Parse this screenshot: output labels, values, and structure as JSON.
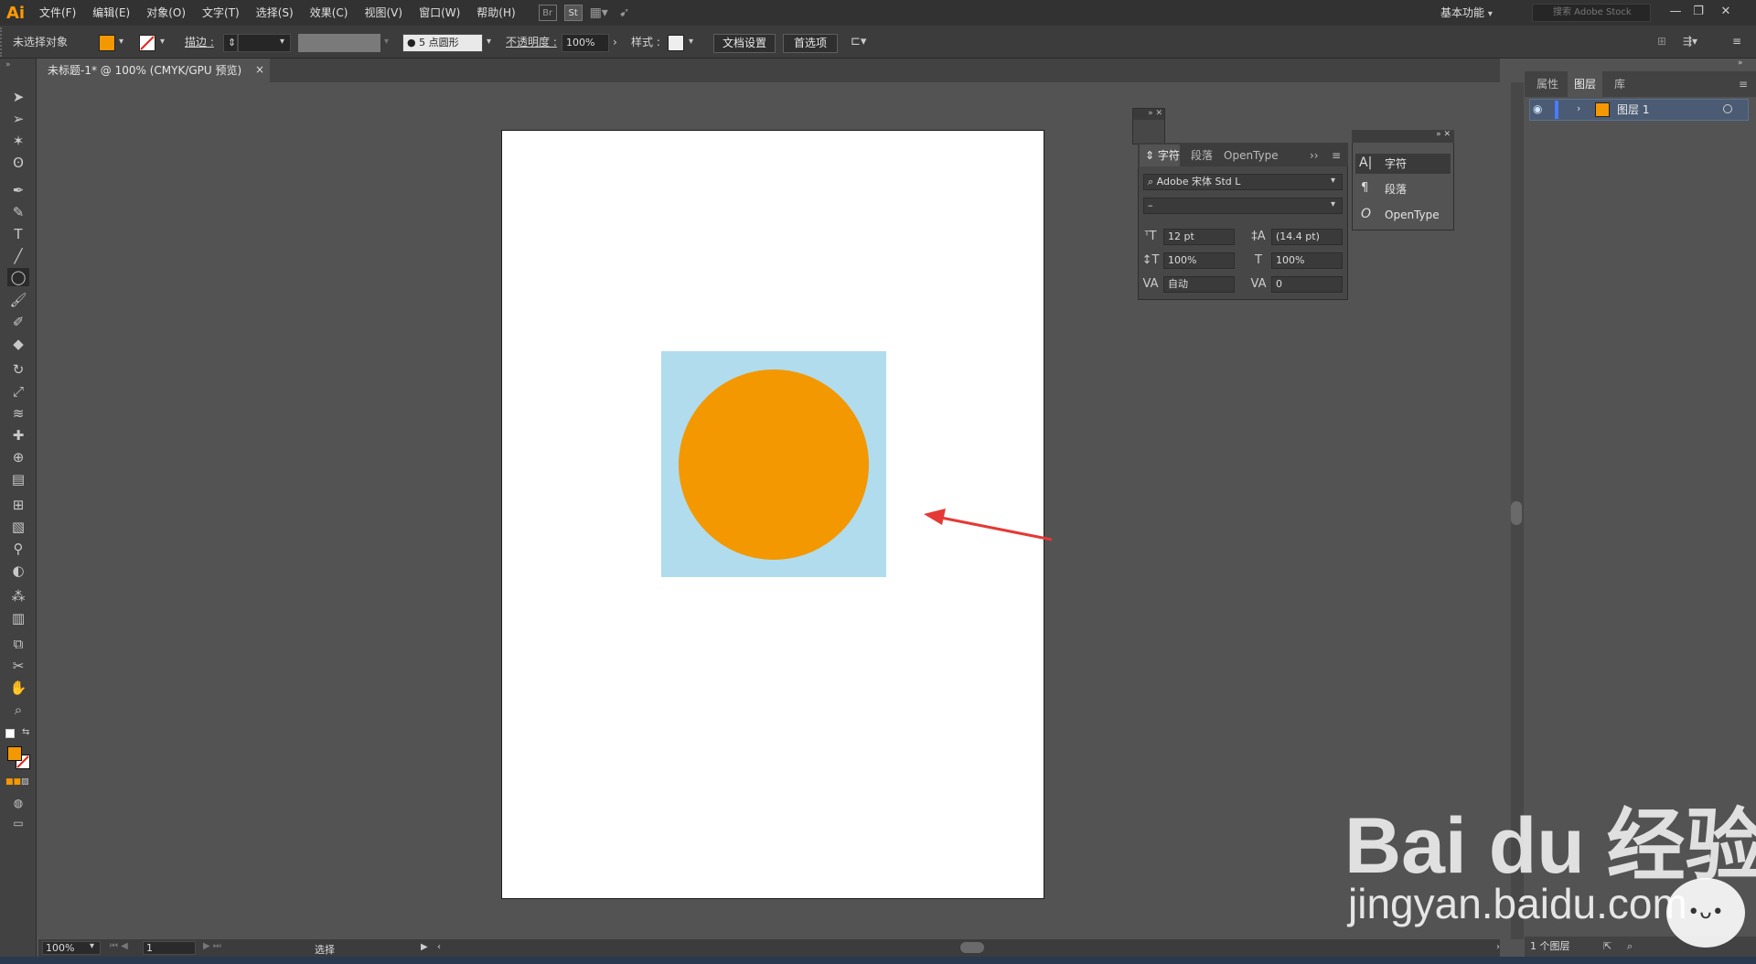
{
  "app": {
    "logo": "Ai"
  },
  "menu": [
    "文件(F)",
    "编辑(E)",
    "对象(O)",
    "文字(T)",
    "选择(S)",
    "效果(C)",
    "视图(V)",
    "窗口(W)",
    "帮助(H)"
  ],
  "menubar_icons": {
    "bridge": "Br",
    "stock": "St"
  },
  "workspace": {
    "label": "基本功能"
  },
  "search": {
    "placeholder": "搜索 Adobe Stock"
  },
  "control_bar": {
    "selection": "未选择对象",
    "stroke_label": "描边 :",
    "brush": "5 点圆形",
    "opacity_label": "不透明度 :",
    "opacity_value": "100%",
    "style_label": "样式 :",
    "doc_setup": "文档设置",
    "preferences": "首选项"
  },
  "document_tab": {
    "title": "未标题-1* @ 100% (CMYK/GPU 预览)",
    "close": "×"
  },
  "colors": {
    "fill": "#f39800",
    "rect": "#b0dcee",
    "circle": "#f39800",
    "arrow": "#e53935"
  },
  "right_panel": {
    "tabs": [
      "属性",
      "图层",
      "库"
    ],
    "active_tab": "图层",
    "layer": {
      "name": "图层 1"
    },
    "footer": "1 个图层"
  },
  "character_panel": {
    "tabs": [
      "字符",
      "段落",
      "OpenType"
    ],
    "font_family": "Adobe 宋体 Std L",
    "font_style": "–",
    "font_size": "12 pt",
    "leading": "(14.4 pt)",
    "vertical_scale": "100%",
    "horizontal_scale": "100%",
    "kerning": "自动",
    "tracking": "0"
  },
  "flyout_menu": [
    "字符",
    "段落",
    "OpenType"
  ],
  "status_bar": {
    "zoom": "100%",
    "page": "1",
    "tool": "选择"
  },
  "watermark": {
    "brand": "Bai du 经验",
    "url": "jingyan.baidu.com"
  }
}
